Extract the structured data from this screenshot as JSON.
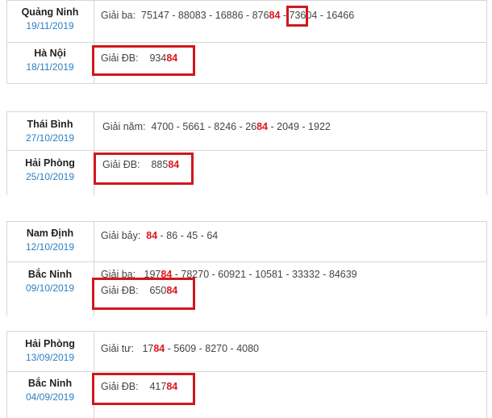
{
  "blocks": [
    {
      "rows": [
        {
          "province": "Quảng Ninh",
          "date": "19/11/2019",
          "prize_label": "Giải ba:",
          "parts": [
            "75147 - 88083 - 16886 - 87",
            "6",
            "84",
            " - 73604 - 16466"
          ]
        },
        {
          "province": "Hà Nội",
          "date": "18/11/2019",
          "prize_label": "Giải ĐB:",
          "parts": [
            "934",
            "84"
          ]
        }
      ]
    },
    {
      "rows": [
        {
          "province": "Thái Bình",
          "date": "27/10/2019",
          "prize_label": "Giải năm:",
          "parts": [
            "4700 - 5661 - 8246 - 26",
            "84",
            " - 2049 - 1922"
          ]
        },
        {
          "province": "Hải Phòng",
          "date": "25/10/2019",
          "prize_label": "Giải ĐB:",
          "parts": [
            "885",
            "84"
          ]
        }
      ]
    },
    {
      "rows": [
        {
          "province": "Nam Định",
          "date": "12/10/2019",
          "prize_label": "Giải bảy:",
          "parts": [
            "84",
            " - 86 - 45 - 64"
          ]
        },
        {
          "province": "Bắc Ninh",
          "date": "09/10/2019",
          "prize_label": "Giải ba:",
          "parts": [
            "197",
            "84",
            " - 78270 - 60921 - 10581 - 33332 - 84639"
          ],
          "prize_label_2": "Giải ĐB:",
          "parts_2": [
            "650",
            "84"
          ]
        }
      ]
    },
    {
      "rows": [
        {
          "province": "Hải Phòng",
          "date": "13/09/2019",
          "prize_label": "Giải tư:",
          "parts": [
            "17",
            "84",
            " - 5609 - 8270 - 4080"
          ]
        },
        {
          "province": "Bắc Ninh",
          "date": "04/09/2019",
          "prize_label": "Giải ĐB:",
          "parts": [
            "417",
            "84"
          ]
        }
      ]
    }
  ],
  "colors": {
    "highlight": "#e0161c",
    "box": "#d0181e",
    "date": "#2b7fc4"
  }
}
